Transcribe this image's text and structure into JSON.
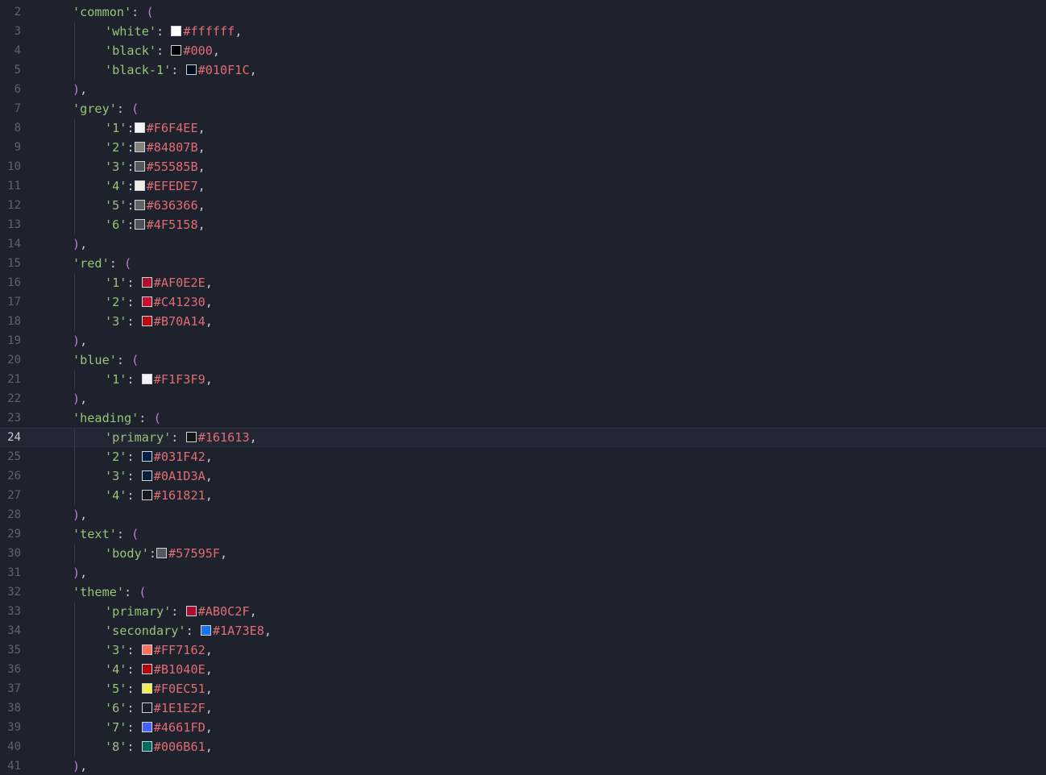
{
  "editor": {
    "lines": [
      {
        "num": "2",
        "indent": 1,
        "kind": "open",
        "key": "'common'"
      },
      {
        "num": "3",
        "indent": 2,
        "kind": "entry",
        "key": "'white'",
        "sep": ": ",
        "color": "#ffffff",
        "hex": "#ffffff"
      },
      {
        "num": "4",
        "indent": 2,
        "kind": "entry",
        "key": "'black'",
        "sep": ": ",
        "color": "#000000",
        "hex": "#000"
      },
      {
        "num": "5",
        "indent": 2,
        "kind": "entry",
        "key": "'black-1'",
        "sep": ": ",
        "color": "#010F1C",
        "hex": "#010F1C"
      },
      {
        "num": "6",
        "indent": 1,
        "kind": "close"
      },
      {
        "num": "7",
        "indent": 1,
        "kind": "open",
        "key": "'grey'"
      },
      {
        "num": "8",
        "indent": 2,
        "kind": "entry",
        "key": "'1'",
        "sep": ":",
        "color": "#F6F4EE",
        "hex": "#F6F4EE"
      },
      {
        "num": "9",
        "indent": 2,
        "kind": "entry",
        "key": "'2'",
        "sep": ":",
        "color": "#84807B",
        "hex": "#84807B"
      },
      {
        "num": "10",
        "indent": 2,
        "kind": "entry",
        "key": "'3'",
        "sep": ":",
        "color": "#55585B",
        "hex": "#55585B"
      },
      {
        "num": "11",
        "indent": 2,
        "kind": "entry",
        "key": "'4'",
        "sep": ":",
        "color": "#EFEDE7",
        "hex": "#EFEDE7"
      },
      {
        "num": "12",
        "indent": 2,
        "kind": "entry",
        "key": "'5'",
        "sep": ":",
        "color": "#636366",
        "hex": "#636366"
      },
      {
        "num": "13",
        "indent": 2,
        "kind": "entry",
        "key": "'6'",
        "sep": ":",
        "color": "#4F5158",
        "hex": "#4F5158"
      },
      {
        "num": "14",
        "indent": 1,
        "kind": "close"
      },
      {
        "num": "15",
        "indent": 1,
        "kind": "open",
        "key": "'red'"
      },
      {
        "num": "16",
        "indent": 2,
        "kind": "entry",
        "key": "'1'",
        "sep": ": ",
        "color": "#AF0E2E",
        "hex": "#AF0E2E"
      },
      {
        "num": "17",
        "indent": 2,
        "kind": "entry",
        "key": "'2'",
        "sep": ": ",
        "color": "#C41230",
        "hex": "#C41230"
      },
      {
        "num": "18",
        "indent": 2,
        "kind": "entry",
        "key": "'3'",
        "sep": ": ",
        "color": "#B70A14",
        "hex": "#B70A14"
      },
      {
        "num": "19",
        "indent": 1,
        "kind": "close"
      },
      {
        "num": "20",
        "indent": 1,
        "kind": "open",
        "key": "'blue'"
      },
      {
        "num": "21",
        "indent": 2,
        "kind": "entry",
        "key": "'1'",
        "sep": ": ",
        "color": "#F1F3F9",
        "hex": "#F1F3F9"
      },
      {
        "num": "22",
        "indent": 1,
        "kind": "close"
      },
      {
        "num": "23",
        "indent": 1,
        "kind": "open",
        "key": "'heading'"
      },
      {
        "num": "24",
        "indent": 2,
        "kind": "entry",
        "key": "'primary'",
        "sep": ": ",
        "color": "#161613",
        "hex": "#161613",
        "current": true
      },
      {
        "num": "25",
        "indent": 2,
        "kind": "entry",
        "key": "'2'",
        "sep": ": ",
        "color": "#031F42",
        "hex": "#031F42"
      },
      {
        "num": "26",
        "indent": 2,
        "kind": "entry",
        "key": "'3'",
        "sep": ": ",
        "color": "#0A1D3A",
        "hex": "#0A1D3A"
      },
      {
        "num": "27",
        "indent": 2,
        "kind": "entry",
        "key": "'4'",
        "sep": ": ",
        "color": "#161821",
        "hex": "#161821"
      },
      {
        "num": "28",
        "indent": 1,
        "kind": "close"
      },
      {
        "num": "29",
        "indent": 1,
        "kind": "open",
        "key": "'text'"
      },
      {
        "num": "30",
        "indent": 2,
        "kind": "entry",
        "key": "'body'",
        "sep": ":",
        "color": "#57595F",
        "hex": "#57595F"
      },
      {
        "num": "31",
        "indent": 1,
        "kind": "close"
      },
      {
        "num": "32",
        "indent": 1,
        "kind": "open",
        "key": "'theme'"
      },
      {
        "num": "33",
        "indent": 2,
        "kind": "entry",
        "key": "'primary'",
        "sep": ": ",
        "color": "#AB0C2F",
        "hex": "#AB0C2F"
      },
      {
        "num": "34",
        "indent": 2,
        "kind": "entry",
        "key": "'secondary'",
        "sep": ": ",
        "color": "#1A73E8",
        "hex": "#1A73E8"
      },
      {
        "num": "35",
        "indent": 2,
        "kind": "entry",
        "key": "'3'",
        "sep": ": ",
        "color": "#FF7162",
        "hex": "#FF7162"
      },
      {
        "num": "36",
        "indent": 2,
        "kind": "entry",
        "key": "'4'",
        "sep": ": ",
        "color": "#B1040E",
        "hex": "#B1040E"
      },
      {
        "num": "37",
        "indent": 2,
        "kind": "entry",
        "key": "'5'",
        "sep": ": ",
        "color": "#F0EC51",
        "hex": "#F0EC51"
      },
      {
        "num": "38",
        "indent": 2,
        "kind": "entry",
        "key": "'6'",
        "sep": ": ",
        "color": "#1E1E2F",
        "hex": "#1E1E2F"
      },
      {
        "num": "39",
        "indent": 2,
        "kind": "entry",
        "key": "'7'",
        "sep": ": ",
        "color": "#4661FD",
        "hex": "#4661FD"
      },
      {
        "num": "40",
        "indent": 2,
        "kind": "entry",
        "key": "'8'",
        "sep": ": ",
        "color": "#006B61",
        "hex": "#006B61"
      },
      {
        "num": "41",
        "indent": 1,
        "kind": "close"
      }
    ],
    "open_paren": "(",
    "close_text": "),",
    "trailing_comma": ","
  }
}
